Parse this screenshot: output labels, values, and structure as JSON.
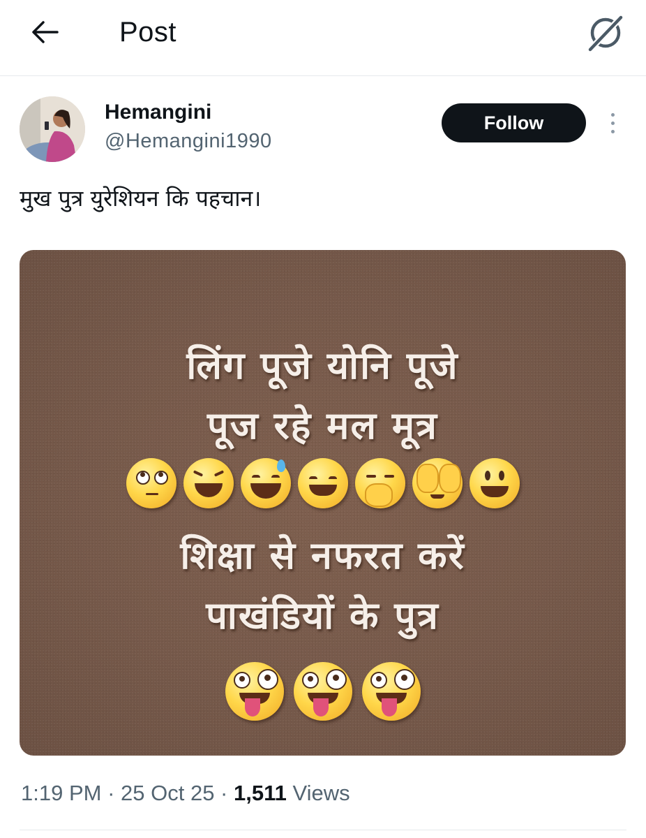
{
  "header": {
    "title": "Post",
    "back_icon": "arrow-left-icon",
    "grok_icon": "grok-icon"
  },
  "author": {
    "display_name": "Hemangini",
    "handle": "@Hemangini1990",
    "follow_label": "Follow",
    "more_icon": "more-vertical-icon"
  },
  "post": {
    "text": "मुख पुत्र युरेशियन कि पहचान।",
    "image_lines": [
      "लिंग पूजे योनि पूजे",
      "पूज रहे मल मूत्र",
      "शिक्षा से नफरत करें",
      "पाखंडियों के पुत्र"
    ],
    "image_emojis_row1": [
      "eye-roll-emoji",
      "laughing-squint-emoji",
      "sweat-smile-emoji",
      "grin-emoji",
      "yawn-emoji",
      "face-palm-emoji",
      "smiley-emoji"
    ],
    "image_emojis_row2": [
      "zany-tongue-emoji",
      "zany-tongue-emoji",
      "zany-tongue-emoji"
    ]
  },
  "meta": {
    "time": "1:19 PM",
    "sep1": " · ",
    "date": "25 Oct 25",
    "sep2": " · ",
    "views_count": "1,511",
    "views_label": " Views"
  },
  "colors": {
    "text_primary": "#0f1419",
    "text_secondary": "#536471",
    "follow_bg": "#0f1419",
    "card_bg": "#76594a",
    "divider": "#e6e9ec"
  }
}
